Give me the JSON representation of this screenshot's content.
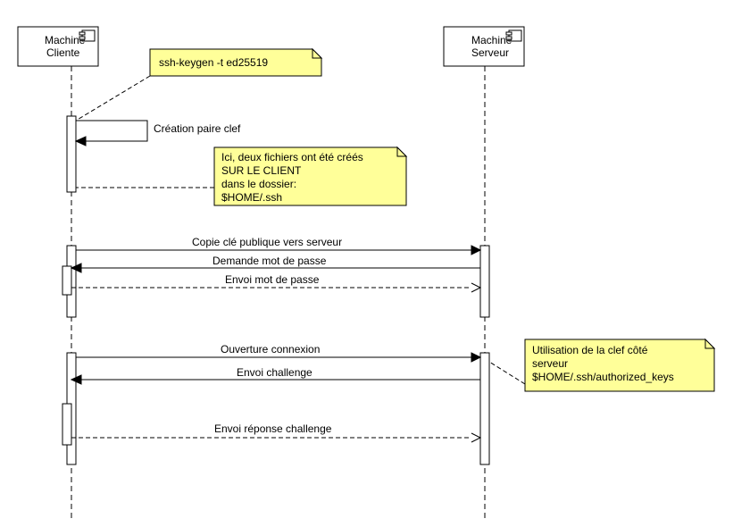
{
  "participants": {
    "client": {
      "name_line1": "Machine",
      "name_line2": "Cliente"
    },
    "server": {
      "name_line1": "Machine",
      "name_line2": "Serveur"
    }
  },
  "notes": {
    "keygen": "ssh-keygen -t ed25519",
    "files_line1": "Ici, deux fichiers ont été créés",
    "files_line2": "SUR LE CLIENT",
    "files_line3": "dans le dossier:",
    "files_line4": "$HOME/.ssh",
    "authkeys_line1": "Utilisation de la clef côté",
    "authkeys_line2": "serveur",
    "authkeys_line3": "$HOME/.ssh/authorized_keys"
  },
  "messages": {
    "create_keypair": "Création paire clef",
    "copy_pubkey": "Copie clé publique vers serveur",
    "ask_password": "Demande mot de passe",
    "send_password": "Envoi mot de passe",
    "open_connection": "Ouverture connexion",
    "send_challenge": "Envoi challenge",
    "send_response": "Envoi réponse challenge"
  }
}
